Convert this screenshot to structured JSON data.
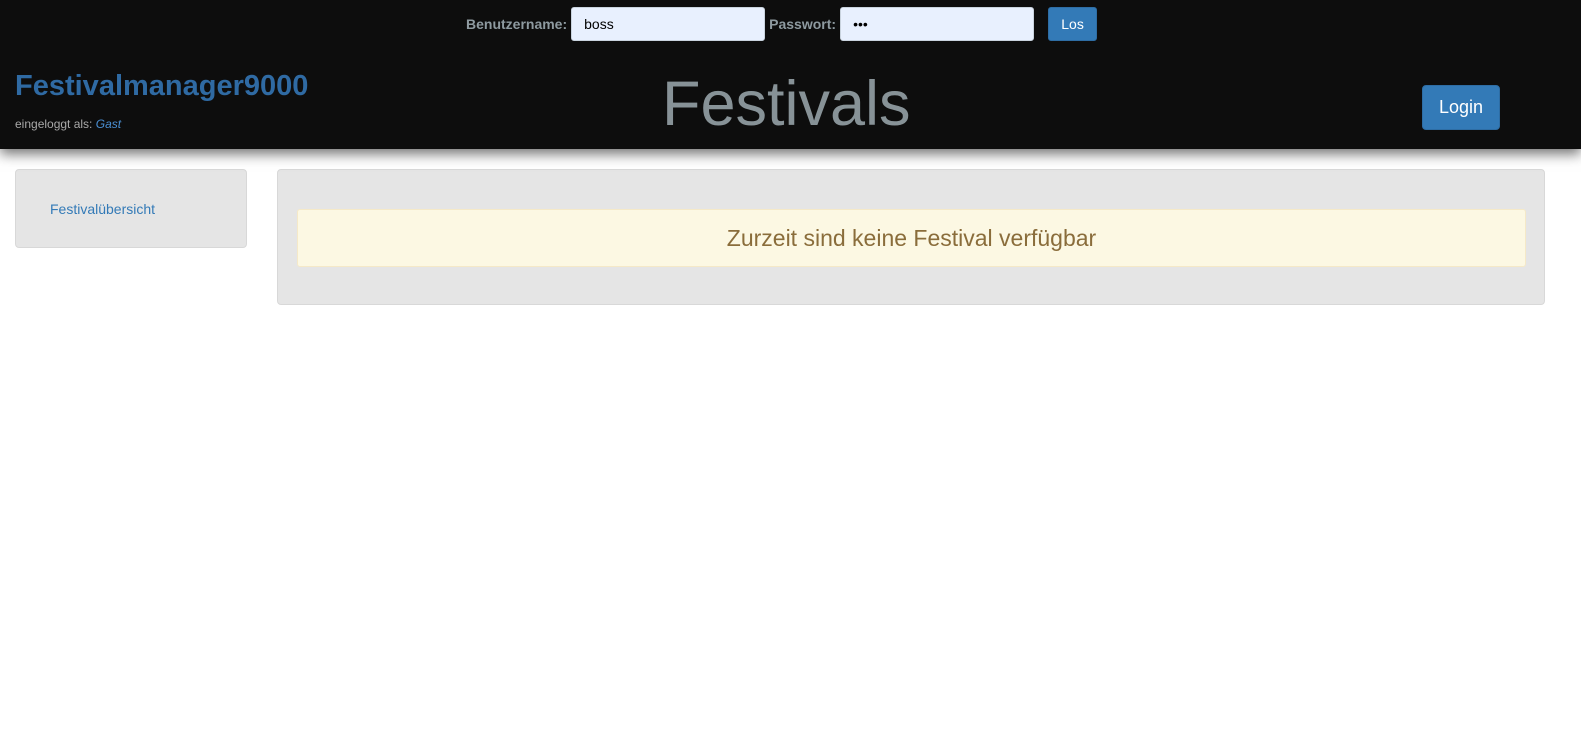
{
  "login_form": {
    "username_label": "Benutzername:",
    "username_value": "boss",
    "password_label": "Passwort:",
    "password_value": "•••",
    "submit_label": "Los"
  },
  "header": {
    "brand": "Festivalmanager9000",
    "logged_in_prefix": "eingeloggt als:",
    "logged_in_user": "Gast",
    "title": "Festivals",
    "login_button": "Login"
  },
  "sidebar": {
    "items": [
      {
        "label": "Festivalübersicht"
      }
    ]
  },
  "main": {
    "alert_text": "Zurzeit sind keine Festival verfügbar"
  },
  "colors": {
    "header_bg": "#0d0d0d",
    "brand": "#2f6aa3",
    "button": "#337ab7",
    "alert_bg": "#fcf8e3",
    "alert_text": "#8a6d3b"
  }
}
